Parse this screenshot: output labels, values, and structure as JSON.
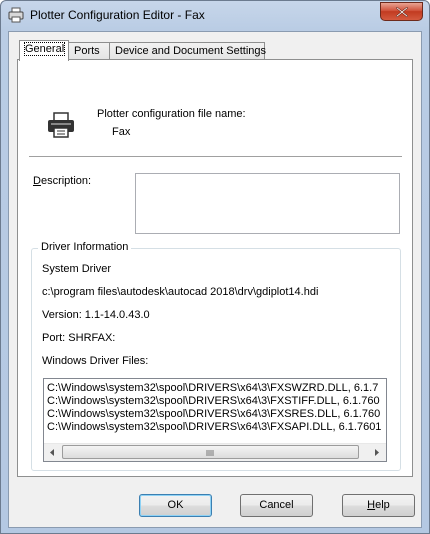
{
  "window": {
    "title": "Plotter Configuration Editor - Fax"
  },
  "tabs": [
    {
      "label": "General",
      "active": true
    },
    {
      "label": "Ports",
      "active": false
    },
    {
      "label": "Device and Document Settings",
      "active": false
    }
  ],
  "general": {
    "config_label": "Plotter configuration file name:",
    "config_value": "Fax",
    "description_label_prefix": "D",
    "description_label_rest": "escription:",
    "description_value": ""
  },
  "driver_info": {
    "group_title": "Driver Information",
    "driver_type": "System Driver",
    "driver_path": "c:\\program files\\autodesk\\autocad 2018\\drv\\gdiplot14.hdi",
    "version": "Version: 1.1-14.0.43.0",
    "port": "Port: SHRFAX:",
    "files_label": "Windows Driver Files:",
    "files": [
      "C:\\Windows\\system32\\spool\\DRIVERS\\x64\\3\\FXSWZRD.DLL, 6.1.7",
      "C:\\Windows\\system32\\spool\\DRIVERS\\x64\\3\\FXSTIFF.DLL, 6.1.760",
      "C:\\Windows\\system32\\spool\\DRIVERS\\x64\\3\\FXSRES.DLL, 6.1.760",
      "C:\\Windows\\system32\\spool\\DRIVERS\\x64\\3\\FXSAPI.DLL, 6.1.7601"
    ]
  },
  "buttons": {
    "ok": "OK",
    "cancel": "Cancel",
    "help_prefix": "H",
    "help_rest": "elp"
  }
}
